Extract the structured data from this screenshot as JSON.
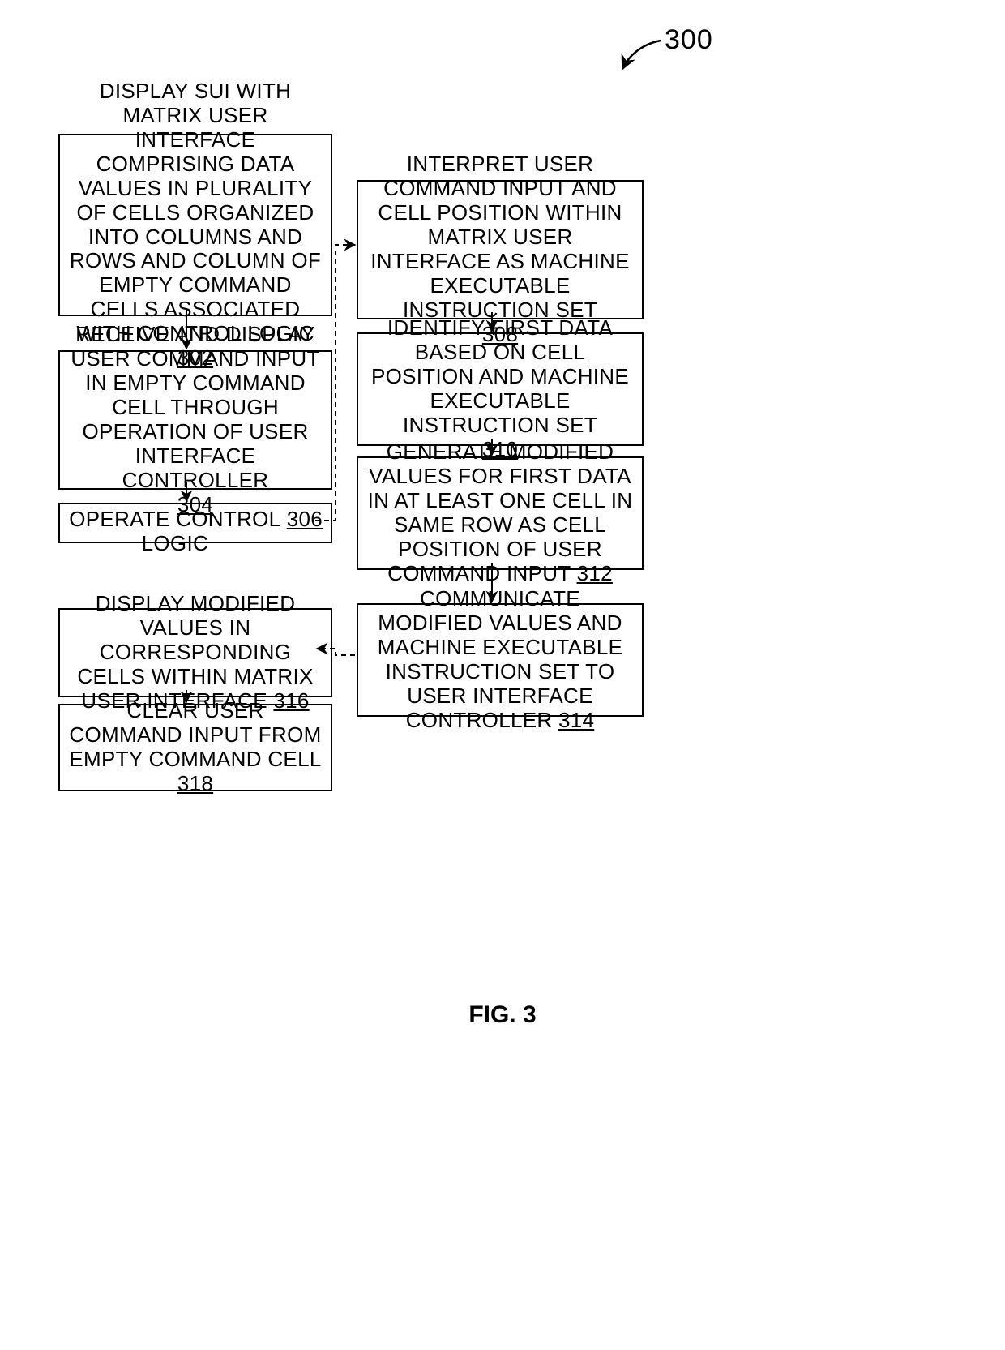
{
  "figure_label": "300",
  "caption": "FIG. 3",
  "boxes": {
    "b302": {
      "text": "DISPLAY SUI WITH MATRIX USER INTERFACE COMPRISING DATA VALUES IN PLURALITY OF CELLS ORGANIZED INTO COLUMNS AND ROWS AND COLUMN OF EMPTY COMMAND CELLS ASSOCIATED WITH CONTROL LOGIC",
      "ref": "302"
    },
    "b304": {
      "text": "RECEIVE AND DISPLAY USER COMMAND INPUT IN EMPTY COMMAND CELL THROUGH OPERATION OF USER INTERFACE CONTROLLER",
      "ref": "304"
    },
    "b306": {
      "text": "OPERATE CONTROL LOGIC",
      "ref": "306"
    },
    "b308": {
      "text": "INTERPRET USER COMMAND INPUT AND CELL POSITION WITHIN MATRIX USER INTERFACE AS MACHINE EXECUTABLE INSTRUCTION SET",
      "ref": "308"
    },
    "b310": {
      "text": "IDENTIFY FIRST DATA BASED ON CELL POSITION AND MACHINE EXECUTABLE INSTRUCTION SET",
      "ref": "310"
    },
    "b312": {
      "text": "GENERATE MODIFIED VALUES FOR FIRST DATA IN AT LEAST ONE CELL IN SAME ROW AS CELL POSITION OF USER COMMAND INPUT",
      "ref": "312"
    },
    "b314": {
      "text": "COMMUNICATE MODIFIED VALUES AND MACHINE EXECUTABLE INSTRUCTION SET TO USER INTERFACE CONTROLLER",
      "ref": "314"
    },
    "b316": {
      "text": "DISPLAY MODIFIED VALUES IN CORRESPONDING CELLS WITHIN MATRIX USER INTERFACE",
      "ref": "316"
    },
    "b318": {
      "text": "CLEAR USER COMMAND INPUT FROM EMPTY COMMAND CELL",
      "ref": "318"
    }
  }
}
